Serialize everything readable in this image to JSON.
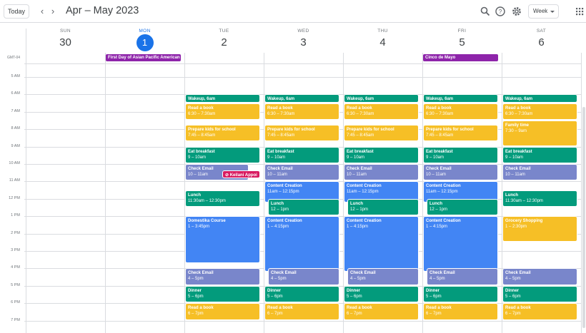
{
  "header": {
    "today_label": "Today",
    "prev_icon": "chevron-left-icon",
    "next_icon": "chevron-right-icon",
    "date_range": "Apr – May 2023",
    "search_icon": "search-icon",
    "help_icon": "help-icon",
    "settings_icon": "gear-icon",
    "view_label": "Week",
    "apps_icon": "apps-grid-icon"
  },
  "timezone": "GMT-04",
  "days": [
    {
      "dow": "SUN",
      "num": "30",
      "today": false
    },
    {
      "dow": "MON",
      "num": "1",
      "today": true
    },
    {
      "dow": "TUE",
      "num": "2",
      "today": false
    },
    {
      "dow": "WED",
      "num": "3",
      "today": false
    },
    {
      "dow": "THU",
      "num": "4",
      "today": false
    },
    {
      "dow": "FRI",
      "num": "5",
      "today": false
    },
    {
      "dow": "SAT",
      "num": "6",
      "today": false
    }
  ],
  "all_day": [
    {
      "day": 1,
      "title": "First Day of Asian Pacific American",
      "color": "#8e24aa"
    },
    {
      "day": 5,
      "title": "Cinco de Mayo",
      "color": "#8e24aa"
    }
  ],
  "hours": [
    "5 AM",
    "6 AM",
    "7 AM",
    "8 AM",
    "9 AM",
    "10 AM",
    "11 AM",
    "12 PM",
    "1 PM",
    "2 PM",
    "3 PM",
    "4 PM",
    "5 PM",
    "6 PM",
    "7 PM"
  ],
  "events": [
    {
      "day": 2,
      "start": 6.0,
      "end": 6.5,
      "title": "Wakeup, 6am",
      "time": "",
      "color": "teal"
    },
    {
      "day": 2,
      "start": 6.5,
      "end": 7.5,
      "title": "Read a book",
      "time": "6:30 – 7:30am",
      "color": "yellow"
    },
    {
      "day": 2,
      "start": 7.75,
      "end": 8.75,
      "title": "Prepare kids for school",
      "time": "7:45 – 8:45am",
      "color": "yellow"
    },
    {
      "day": 2,
      "start": 9.0,
      "end": 10.0,
      "title": "Eat breakfast",
      "time": "9 – 10am",
      "color": "teal"
    },
    {
      "day": 2,
      "start": 10.0,
      "end": 11.0,
      "title": "Check Email",
      "time": "10 – 11am",
      "color": "lav",
      "narrow": true
    },
    {
      "day": 2,
      "start": 10.35,
      "end": 10.85,
      "title": "Keilani Appoin",
      "time": "",
      "color": "pink",
      "offset": true,
      "icon": true
    },
    {
      "day": 2,
      "start": 11.5,
      "end": 12.5,
      "title": "Lunch",
      "time": "11:30am – 12:30pm",
      "color": "teal"
    },
    {
      "day": 2,
      "start": 13.0,
      "end": 15.75,
      "title": "Domestika Course",
      "time": "1 – 3:45pm",
      "color": "blue"
    },
    {
      "day": 2,
      "start": 16.0,
      "end": 17.0,
      "title": "Check Email",
      "time": "4 – 5pm",
      "color": "lav"
    },
    {
      "day": 2,
      "start": 17.0,
      "end": 18.0,
      "title": "Dinner",
      "time": "5 – 6pm",
      "color": "teal"
    },
    {
      "day": 2,
      "start": 18.0,
      "end": 19.0,
      "title": "Read a book",
      "time": "6 – 7pm",
      "color": "yellow"
    },
    {
      "day": 3,
      "start": 6.0,
      "end": 6.5,
      "title": "Wakeup, 6am",
      "time": "",
      "color": "teal"
    },
    {
      "day": 3,
      "start": 6.5,
      "end": 7.5,
      "title": "Read a book",
      "time": "6:30 – 7:30am",
      "color": "yellow"
    },
    {
      "day": 3,
      "start": 7.75,
      "end": 8.75,
      "title": "Prepare kids for school",
      "time": "7:45 – 8:45am",
      "color": "yellow"
    },
    {
      "day": 3,
      "start": 9.0,
      "end": 10.0,
      "title": "Eat breakfast",
      "time": "9 – 10am",
      "color": "teal"
    },
    {
      "day": 3,
      "start": 10.0,
      "end": 11.0,
      "title": "Check Email",
      "time": "10 – 11am",
      "color": "lav"
    },
    {
      "day": 3,
      "start": 11.0,
      "end": 12.25,
      "title": "Content Creation",
      "time": "11am – 12:15pm",
      "color": "blue"
    },
    {
      "day": 3,
      "start": 12.0,
      "end": 13.0,
      "title": "Lunch",
      "time": "12 – 1pm",
      "color": "teal",
      "offset": true
    },
    {
      "day": 3,
      "start": 13.0,
      "end": 16.25,
      "title": "Content Creation",
      "time": "1 – 4:15pm",
      "color": "blue"
    },
    {
      "day": 3,
      "start": 16.0,
      "end": 17.0,
      "title": "Check Email",
      "time": "4 – 5pm",
      "color": "lav",
      "offset": true
    },
    {
      "day": 3,
      "start": 17.0,
      "end": 18.0,
      "title": "Dinner",
      "time": "5 – 6pm",
      "color": "teal"
    },
    {
      "day": 3,
      "start": 18.0,
      "end": 19.0,
      "title": "Read a book",
      "time": "6 – 7pm",
      "color": "yellow"
    },
    {
      "day": 4,
      "start": 6.0,
      "end": 6.5,
      "title": "Wakeup, 6am",
      "time": "",
      "color": "teal"
    },
    {
      "day": 4,
      "start": 6.5,
      "end": 7.5,
      "title": "Read a book",
      "time": "6:30 – 7:30am",
      "color": "yellow"
    },
    {
      "day": 4,
      "start": 7.75,
      "end": 8.75,
      "title": "Prepare kids for school",
      "time": "7:45 – 8:45am",
      "color": "yellow"
    },
    {
      "day": 4,
      "start": 9.0,
      "end": 10.0,
      "title": "Eat breakfast",
      "time": "9 – 10am",
      "color": "teal"
    },
    {
      "day": 4,
      "start": 10.0,
      "end": 11.0,
      "title": "Check Email",
      "time": "10 – 11am",
      "color": "lav"
    },
    {
      "day": 4,
      "start": 11.0,
      "end": 12.25,
      "title": "Content Creation",
      "time": "11am – 12:15pm",
      "color": "blue"
    },
    {
      "day": 4,
      "start": 12.0,
      "end": 13.0,
      "title": "Lunch",
      "time": "12 – 1pm",
      "color": "teal",
      "offset": true
    },
    {
      "day": 4,
      "start": 13.0,
      "end": 16.25,
      "title": "Content Creation",
      "time": "1 – 4:15pm",
      "color": "blue"
    },
    {
      "day": 4,
      "start": 16.0,
      "end": 17.0,
      "title": "Check Email",
      "time": "4 – 5pm",
      "color": "lav",
      "offset": true
    },
    {
      "day": 4,
      "start": 17.0,
      "end": 18.0,
      "title": "Dinner",
      "time": "5 – 6pm",
      "color": "teal"
    },
    {
      "day": 4,
      "start": 18.0,
      "end": 19.0,
      "title": "Read a book",
      "time": "6 – 7pm",
      "color": "yellow"
    },
    {
      "day": 5,
      "start": 6.0,
      "end": 6.5,
      "title": "Wakeup, 6am",
      "time": "",
      "color": "teal"
    },
    {
      "day": 5,
      "start": 6.5,
      "end": 7.5,
      "title": "Read a book",
      "time": "6:30 – 7:30am",
      "color": "yellow"
    },
    {
      "day": 5,
      "start": 7.75,
      "end": 8.75,
      "title": "Prepare kids for school",
      "time": "7:45 – 8:45am",
      "color": "yellow"
    },
    {
      "day": 5,
      "start": 9.0,
      "end": 10.0,
      "title": "Eat breakfast",
      "time": "9 – 10am",
      "color": "teal"
    },
    {
      "day": 5,
      "start": 10.0,
      "end": 11.0,
      "title": "Check Email",
      "time": "10 – 11am",
      "color": "lav"
    },
    {
      "day": 5,
      "start": 11.0,
      "end": 12.25,
      "title": "Content Creation",
      "time": "11am – 12:15pm",
      "color": "blue"
    },
    {
      "day": 5,
      "start": 12.0,
      "end": 13.0,
      "title": "Lunch",
      "time": "12 – 1pm",
      "color": "teal",
      "offset": true
    },
    {
      "day": 5,
      "start": 13.0,
      "end": 16.25,
      "title": "Content Creation",
      "time": "1 – 4:15pm",
      "color": "blue"
    },
    {
      "day": 5,
      "start": 16.0,
      "end": 17.0,
      "title": "Check Email",
      "time": "4 – 5pm",
      "color": "lav",
      "offset": true
    },
    {
      "day": 5,
      "start": 17.0,
      "end": 18.0,
      "title": "Dinner",
      "time": "5 – 6pm",
      "color": "teal"
    },
    {
      "day": 5,
      "start": 18.0,
      "end": 19.0,
      "title": "Read a book",
      "time": "6 – 7pm",
      "color": "yellow"
    },
    {
      "day": 6,
      "start": 6.0,
      "end": 6.5,
      "title": "Wakeup, 6am",
      "time": "",
      "color": "teal"
    },
    {
      "day": 6,
      "start": 6.5,
      "end": 7.5,
      "title": "Read a book",
      "time": "6:30 – 7:30am",
      "color": "yellow"
    },
    {
      "day": 6,
      "start": 7.5,
      "end": 9.0,
      "title": "Family time",
      "time": "7:30 – 9am",
      "color": "yellow"
    },
    {
      "day": 6,
      "start": 9.0,
      "end": 10.0,
      "title": "Eat breakfast",
      "time": "9 – 10am",
      "color": "teal"
    },
    {
      "day": 6,
      "start": 10.0,
      "end": 11.0,
      "title": "Check Email",
      "time": "10 – 11am",
      "color": "lav"
    },
    {
      "day": 6,
      "start": 11.5,
      "end": 12.5,
      "title": "Lunch",
      "time": "11:30am – 12:30pm",
      "color": "teal"
    },
    {
      "day": 6,
      "start": 13.0,
      "end": 14.5,
      "title": "Grocery Shopping",
      "time": "1 – 2:30pm",
      "color": "yellow"
    },
    {
      "day": 6,
      "start": 16.0,
      "end": 17.0,
      "title": "Check Email",
      "time": "4 – 5pm",
      "color": "lav"
    },
    {
      "day": 6,
      "start": 17.0,
      "end": 18.0,
      "title": "Dinner",
      "time": "5 – 6pm",
      "color": "teal"
    },
    {
      "day": 6,
      "start": 18.0,
      "end": 19.0,
      "title": "Read a book",
      "time": "6 – 7pm",
      "color": "yellow"
    }
  ]
}
